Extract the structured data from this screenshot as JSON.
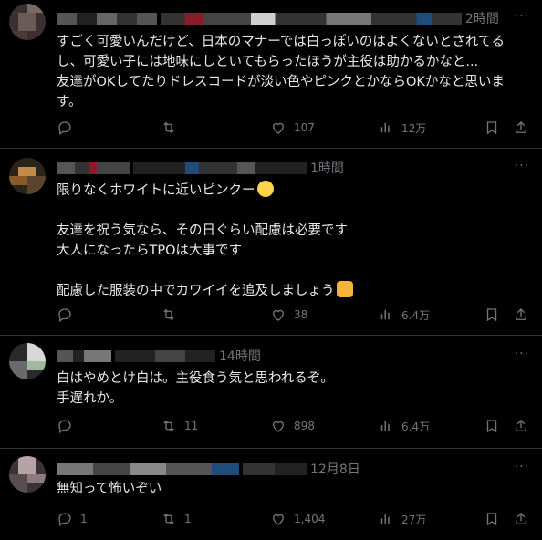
{
  "tweets": [
    {
      "time": "2時間",
      "more": "···",
      "lines": [
        "すごく可愛いんだけど、日本のマナーでは白っぽいのはよくないとされてる",
        "し、可愛い子には地味にしといてもらったほうが主役は助かるかなと...",
        "友達がOKしてたりドレスコードが淡い色やピンクとかならOKかなと思いま",
        "す。"
      ],
      "actions": {
        "reply": "",
        "retweet": "",
        "like": "107",
        "views": "12万"
      }
    },
    {
      "time": "1時間",
      "more": "···",
      "lines": [
        "限りなくホワイトに近いピンクー",
        "",
        "友達を祝う気なら、その日ぐらい配慮は必要です",
        "大人になったらTPOは大事です",
        "",
        "配慮した服装の中でカワイイを追及しましょう"
      ],
      "emoji_names": [
        "grinning-sweat-emoji",
        "thumbs-up-emoji"
      ],
      "actions": {
        "reply": "",
        "retweet": "",
        "like": "38",
        "views": "6.4万"
      }
    },
    {
      "time": "14時間",
      "more": "···",
      "lines": [
        "白はやめとけ白は。主役食う気と思われるぞ。",
        "手遅れか。"
      ],
      "actions": {
        "reply": "",
        "retweet": "11",
        "like": "898",
        "views": "6.4万"
      }
    },
    {
      "time": "12月8日",
      "more": "···",
      "lines": [
        "無知って怖いぞい"
      ],
      "actions": {
        "reply": "1",
        "retweet": "1",
        "like": "1,404",
        "views": "27万"
      }
    }
  ],
  "icons": [
    "reply-icon",
    "retweet-icon",
    "like-icon",
    "views-icon",
    "bookmark-icon",
    "share-icon",
    "more-icon"
  ],
  "colors": {
    "background": "#000000",
    "text": "#e7e9ea",
    "muted": "#71767b",
    "divider": "#2f3336"
  }
}
